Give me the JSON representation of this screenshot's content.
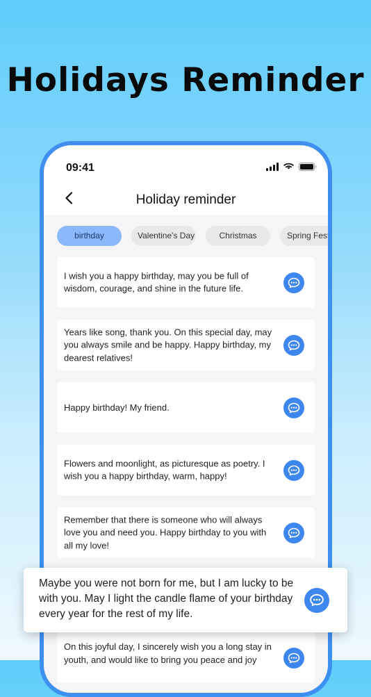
{
  "headline": "Holidays Reminder",
  "status_bar": {
    "time": "09:41"
  },
  "nav": {
    "title": "Holiday reminder",
    "back_icon": "chevron-left-icon"
  },
  "tabs": [
    {
      "label": "birthday",
      "active": true
    },
    {
      "label": "Valentine's Day",
      "active": false
    },
    {
      "label": "Christmas",
      "active": false
    },
    {
      "label": "Spring Fest",
      "active": false
    }
  ],
  "messages": [
    {
      "text": "I wish you a happy birthday, may you be full of wisdom, courage, and shine in the future life."
    },
    {
      "text": "Years like song, thank you. On this special day, may you always smile and be happy. Happy birthday, my dearest relatives!"
    },
    {
      "text": "Happy birthday! My friend."
    },
    {
      "text": "Flowers and moonlight, as picturesque as poetry. I wish you a happy birthday, warm, happy!"
    },
    {
      "text": "Remember that there is someone who will always love you and need you. Happy birthday to you with all my love!"
    },
    {
      "text": ""
    },
    {
      "text": "On this joyful day, I sincerely wish you a long stay in youth, and would like to bring you peace and joy"
    }
  ],
  "highlight": {
    "text": "Maybe you were not born for me, but I am lucky to be with you. May I light the candle flame of your birthday every year for the rest of my life."
  },
  "colors": {
    "accent": "#3d87ef",
    "frame": "#3d8ff0",
    "active_tab": "#8ab8fb",
    "background_top": "#5fcdfb"
  }
}
